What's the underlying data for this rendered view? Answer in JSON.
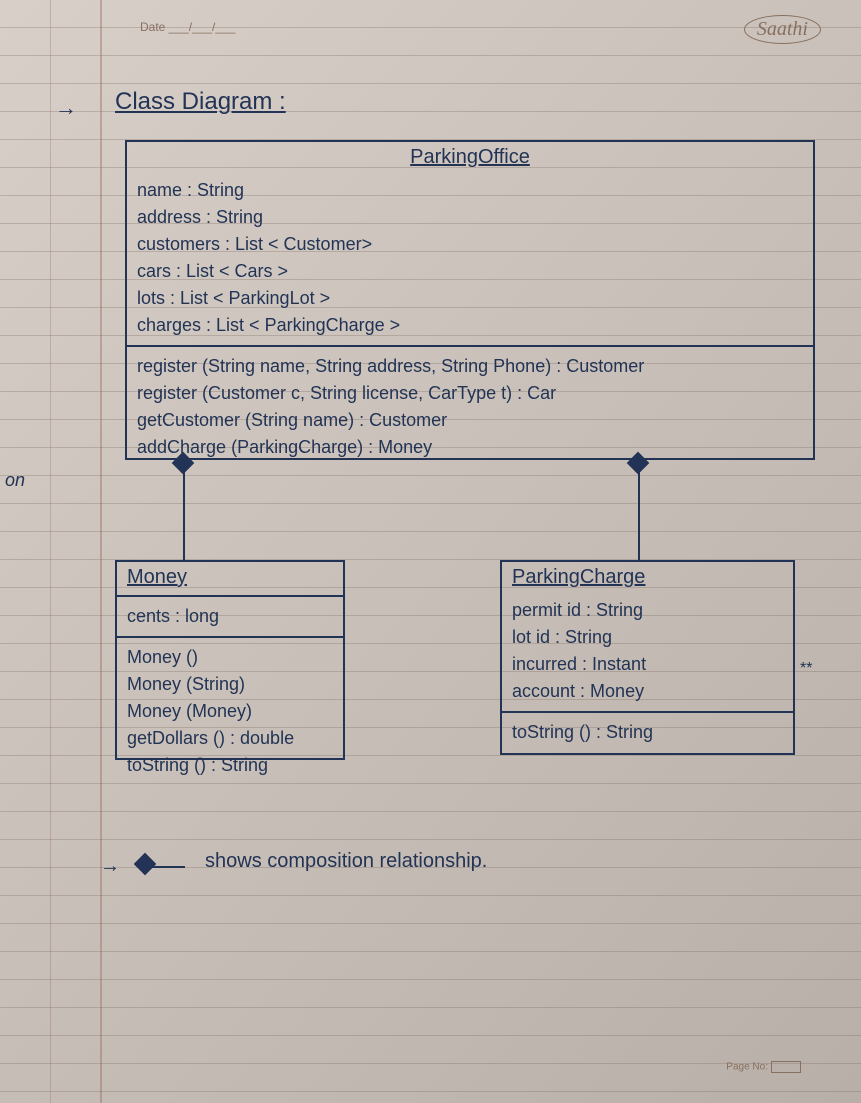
{
  "header": {
    "date_label": "Date ___/___/___",
    "brand": "Saathi",
    "page_no_label": "Page No:"
  },
  "title": "Class Diagram :",
  "arrow_glyph": "→",
  "classes": {
    "parking_office": {
      "name": "ParkingOffice",
      "attributes": [
        "name : String",
        "address : String",
        "customers : List < Customer>",
        "cars : List < Cars >",
        "lots : List < ParkingLot >",
        "charges : List < ParkingCharge >"
      ],
      "methods": [
        "register (String name, String address, String Phone) : Customer",
        "register (Customer c, String license, CarType t) : Car",
        "getCustomer (String name) : Customer",
        "addCharge (ParkingCharge) : Money"
      ]
    },
    "money": {
      "name": "Money",
      "attributes": [
        "cents : long"
      ],
      "methods": [
        "Money ()",
        "Money (String)",
        "Money (Money)",
        "getDollars () : double",
        "toString () : String"
      ]
    },
    "parking_charge": {
      "name": "ParkingCharge",
      "attributes": [
        "permit id : String",
        "lot id : String",
        "incurred : Instant",
        "account : Money"
      ],
      "methods": [
        "toString () : String"
      ]
    }
  },
  "legend": "shows composition relationship.",
  "edge_label": "on",
  "star_marker": "**"
}
